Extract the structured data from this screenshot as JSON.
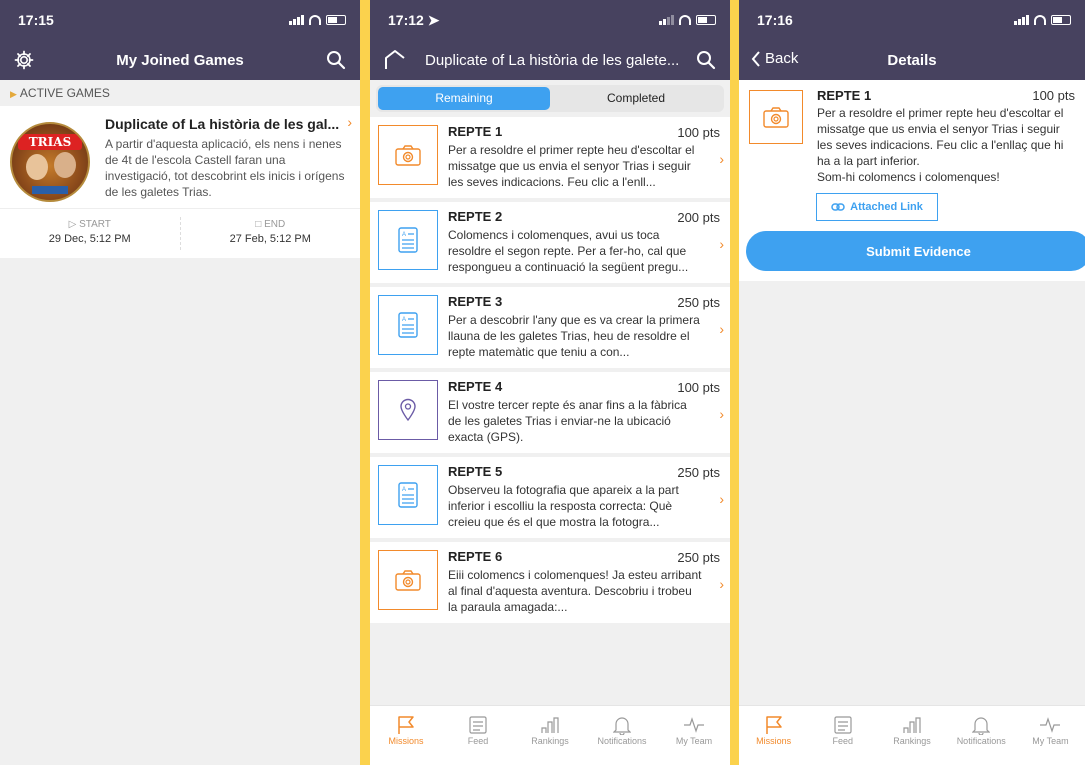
{
  "panel1": {
    "status_time": "17:15",
    "title": "My Joined Games",
    "section": "ACTIVE GAMES",
    "game": {
      "brand": "TRIAS",
      "title": "Duplicate of La història de les gal...",
      "description": "A partir d'aquesta aplicació, els nens i nenes de 4t de l'escola Castell faran una investigació, tot descobrint els inicis i orígens de les galetes Trias.",
      "start_label": "START",
      "start_date": "29 Dec, 5:12 PM",
      "end_label": "END",
      "end_date": "27 Feb, 5:12 PM"
    }
  },
  "panel2": {
    "status_time": "17:12",
    "title": "Duplicate of La història de les galete...",
    "tabs": [
      "Remaining",
      "Completed"
    ],
    "missions": [
      {
        "title": "REPTE 1",
        "points": "100 pts",
        "icon": "camera-icon",
        "desc": "Per a resoldre el primer repte heu d'escoltar el missatge que us envia el senyor Trias i seguir les seves indicacions. Feu clic a l'enll..."
      },
      {
        "title": "REPTE 2",
        "points": "200 pts",
        "icon": "quiz-icon",
        "desc": "Colomencs i colomenques, avui us toca resoldre el segon repte. Per a fer-ho, cal que respongueu a continuació la següent pregu..."
      },
      {
        "title": "REPTE 3",
        "points": "250 pts",
        "icon": "quiz-icon",
        "desc": "Per a descobrir l'any que es va crear la primera llauna de les galetes Trias, heu de resoldre el repte matemàtic que teniu a con..."
      },
      {
        "title": "REPTE 4",
        "points": "100 pts",
        "icon": "location-icon",
        "desc": "El vostre tercer repte és anar fins a la fàbrica de les galetes Trias i enviar-ne la ubicació exacta (GPS)."
      },
      {
        "title": "REPTE 5",
        "points": "250 pts",
        "icon": "quiz-icon",
        "desc": "Observeu la fotografia que apareix a la part inferior i escolliu la resposta correcta: Què creieu que és el que mostra la fotogra..."
      },
      {
        "title": "REPTE 6",
        "points": "250 pts",
        "icon": "camera-icon",
        "desc": "Eiii colomencs i colomenques! Ja esteu arribant al final d'aquesta aventura. Descobriu i trobeu la paraula amagada:..."
      }
    ]
  },
  "panel3": {
    "status_time": "17:16",
    "back": "Back",
    "title": "Details",
    "mission": {
      "title": "REPTE 1",
      "points": "100 pts",
      "desc": "Per a resoldre el primer repte heu d'escoltar el missatge que us envia el senyor Trias i seguir les seves indicacions. Feu clic a l'enllaç que hi ha a la part inferior.",
      "desc2": "Som-hi colomencs i colomenques!",
      "link": "Attached Link"
    },
    "submit": "Submit Evidence"
  },
  "tabbar": [
    "Missions",
    "Feed",
    "Rankings",
    "Notifications",
    "My Team"
  ],
  "colors": {
    "nav": "#47425f",
    "accent": "#f28a2b",
    "blue": "#3ea1f0",
    "purple": "#6b5ba6",
    "background": "#fbd24d"
  }
}
